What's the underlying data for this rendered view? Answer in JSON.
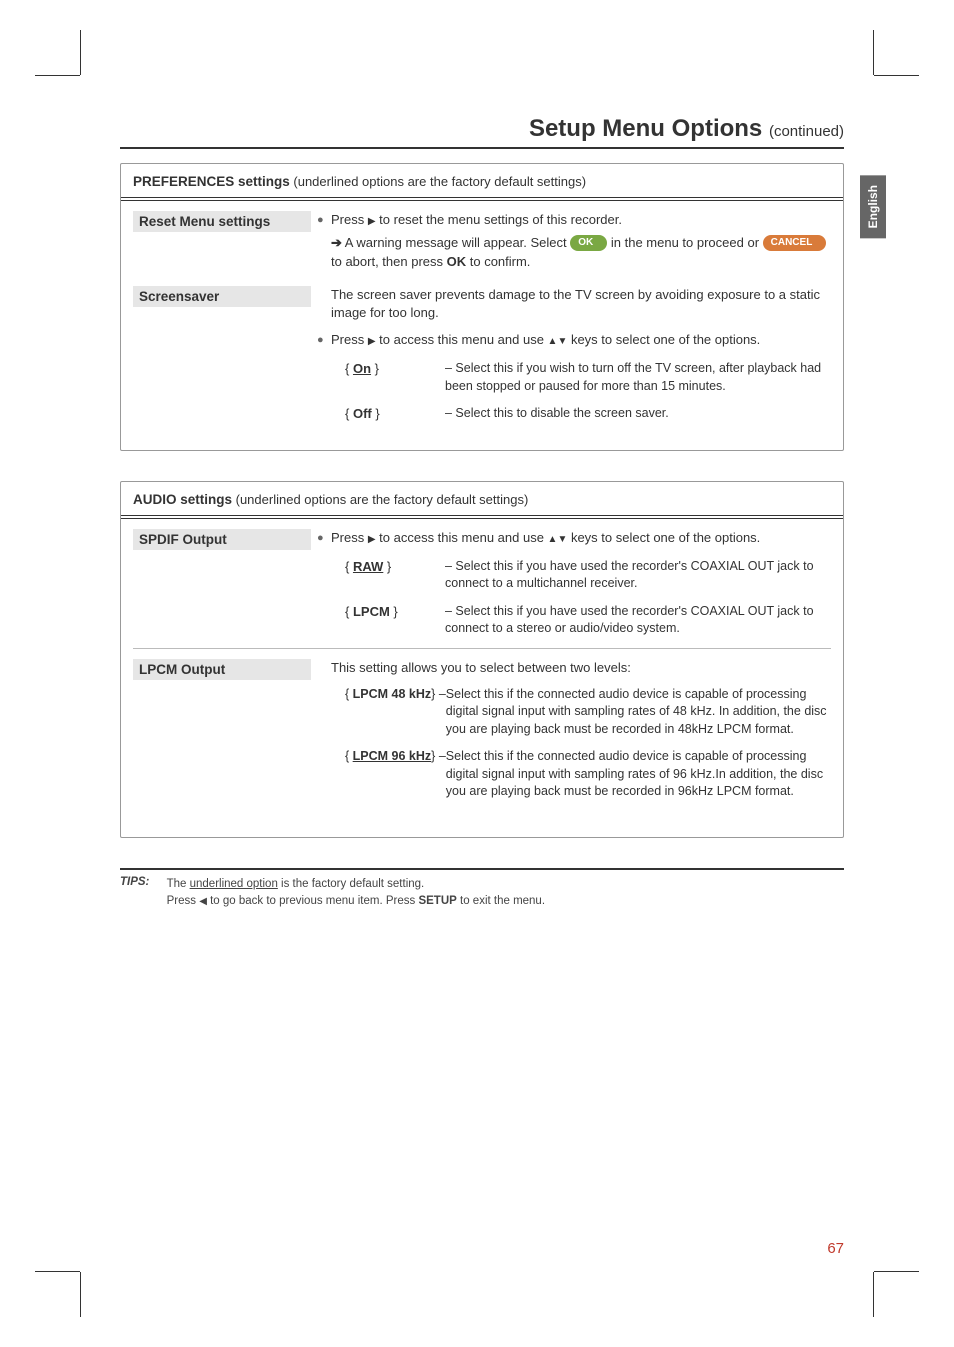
{
  "page": {
    "title": "Setup Menu Options",
    "continued": "(continued)",
    "language_tab": "English",
    "page_number": "67"
  },
  "prefs": {
    "header_strong": "PREFERENCES settings",
    "header_note": " (underlined options are the factory default settings)",
    "reset": {
      "label": "Reset Menu settings",
      "line1_a": "Press ",
      "line1_b": " to reset the menu settings of this recorder.",
      "line2_a": " A warning message will appear. Select ",
      "ok_pill": "OK",
      "line2_b": " in the menu to proceed or ",
      "cancel_pill": "CANCEL",
      "line2_c": " to abort, then press ",
      "ok_bold": "OK",
      "line2_d": " to confirm."
    },
    "screensaver": {
      "label": "Screensaver",
      "intro": "The screen saver prevents damage to the TV screen by avoiding  exposure to a static image for too long.",
      "bullet_a": "Press ",
      "bullet_b": " to access this menu and use ",
      "bullet_c": " keys to select one of the options.",
      "on_key": "On",
      "on_val": "– Select this if you wish to turn off the TV screen, after playback had been stopped or paused for more than 15 minutes.",
      "off_key": "Off",
      "off_val": "– Select this to disable the screen saver."
    }
  },
  "audio": {
    "header_strong": "AUDIO settings",
    "header_note": " (underlined options are the factory default settings)",
    "spdif": {
      "label": "SPDIF Output",
      "bullet_a": "Press ",
      "bullet_b": " to access this menu and use ",
      "bullet_c": " keys to select one of the options.",
      "raw_key": "RAW",
      "raw_val": "– Select this if you have used the recorder's COAXIAL OUT jack to connect to a multichannel receiver.",
      "lpcm_key": "LPCM",
      "lpcm_val": "– Select this if you have used the recorder's COAXIAL OUT jack to connect to a stereo or audio/video system."
    },
    "lpcm": {
      "label": "LPCM Output",
      "intro": "This setting allows you to select between two levels:",
      "k48_key": "LPCM 48 kHz",
      "k48_dash": " – ",
      "k48_val": "Select this if the connected audio device is capable of processing digital signal input with sampling rates of 48 kHz. In addition, the disc you are playing back must be recorded in 48kHz LPCM format.",
      "k96_key": "LPCM 96 kHz",
      "k96_dash": " – ",
      "k96_val": "Select this if the connected audio device is capable of processing digital signal input with sampling rates of 96 kHz.In addition, the disc you are playing back must be recorded in 96kHz LPCM format."
    }
  },
  "tips": {
    "label": "TIPS:",
    "line1_a": "The ",
    "line1_u": "underlined option",
    "line1_b": " is the factory default setting.",
    "line2_a": "Press ",
    "line2_b": " to go back to previous menu item. Press ",
    "setup_bold": "SETUP",
    "line2_c": " to exit the menu."
  }
}
